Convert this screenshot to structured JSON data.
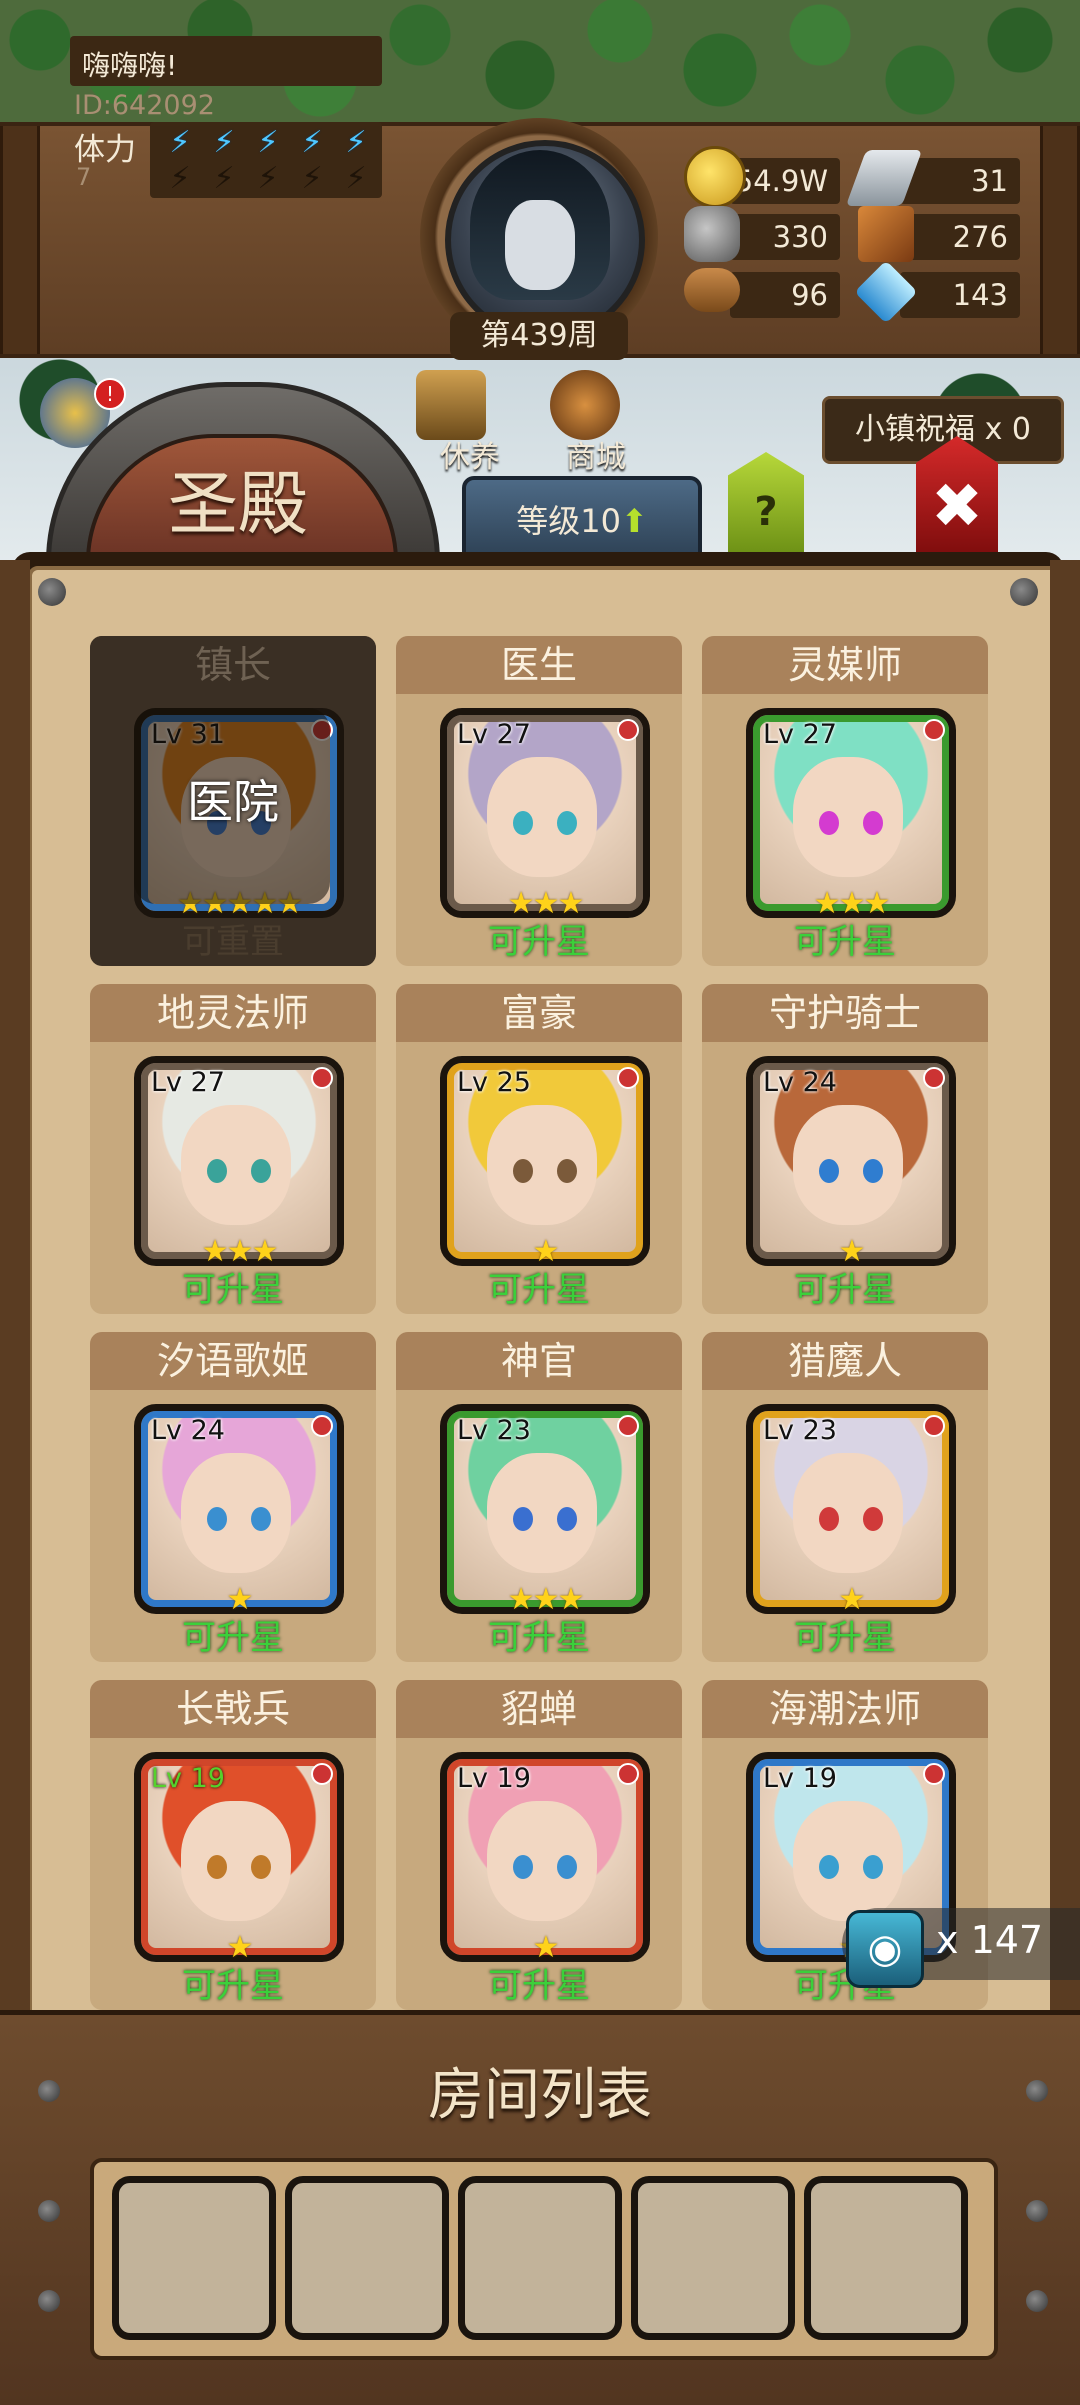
{
  "player": {
    "name": "嗨嗨嗨!",
    "id": "ID:642092",
    "stamina_label": "体力",
    "stamina_value": "7",
    "stamina_bolts_filled": 5,
    "stamina_bolts_total": 10,
    "week": "第439周"
  },
  "resources": {
    "gold": "54.9W",
    "iron": "31",
    "stone": "330",
    "leather": "276",
    "wood": "96",
    "crystal": "143"
  },
  "buildings": {
    "rest_label": "休养",
    "market_label": "商城",
    "blessing": "小镇祝福 x 0"
  },
  "hall": {
    "title": "圣殿",
    "level": "等级10",
    "help": "?",
    "close": "✖"
  },
  "heroes": [
    {
      "title": "镇长",
      "lv": "Lv 31",
      "stars": 5,
      "status": "可重置",
      "overlay": "医院",
      "frame": "#2f6fb3",
      "hair": "#e0801e",
      "eye": "#3a7bd5",
      "dim": true
    },
    {
      "title": "医生",
      "lv": "Lv 27",
      "stars": 3,
      "status": "可升星",
      "overlay": "",
      "frame": "#6b5a4a",
      "hair": "#b3a5c8",
      "eye": "#3bb0c0",
      "dim": false
    },
    {
      "title": "灵媒师",
      "lv": "Lv 27",
      "stars": 3,
      "status": "可升星",
      "overlay": "",
      "frame": "#3a9a2e",
      "hair": "#7fe0c4",
      "eye": "#d43bd0",
      "dim": false
    },
    {
      "title": "地灵法师",
      "lv": "Lv 27",
      "stars": 3,
      "status": "可升星",
      "overlay": "",
      "frame": "#6b5a4a",
      "hair": "#e6e9e3",
      "eye": "#3aa39a",
      "dim": false
    },
    {
      "title": "富豪",
      "lv": "Lv 25",
      "stars": 1,
      "status": "可升星",
      "overlay": "",
      "frame": "#e0a21c",
      "hair": "#f1c93a",
      "eye": "#7b5a3a",
      "dim": false
    },
    {
      "title": "守护骑士",
      "lv": "Lv 24",
      "stars": 1,
      "status": "可升星",
      "overlay": "",
      "frame": "#6b5a4a",
      "hair": "#b9683a",
      "eye": "#2f7dd0",
      "dim": false
    },
    {
      "title": "汐语歌姬",
      "lv": "Lv 24",
      "stars": 1,
      "status": "可升星",
      "overlay": "",
      "frame": "#2f78c8",
      "hair": "#e6a6d8",
      "eye": "#3a8fd0",
      "dim": false
    },
    {
      "title": "神官",
      "lv": "Lv 23",
      "stars": 3,
      "status": "可升星",
      "overlay": "",
      "frame": "#3a9a2e",
      "hair": "#6fd1a0",
      "eye": "#3a6fd0",
      "dim": false
    },
    {
      "title": "猎魔人",
      "lv": "Lv 23",
      "stars": 1,
      "status": "可升星",
      "overlay": "",
      "frame": "#e0a21c",
      "hair": "#d9d4e4",
      "eye": "#d03a3a",
      "dim": false
    },
    {
      "title": "长戟兵",
      "lv": "Lv 19",
      "stars": 1,
      "status": "可升星",
      "overlay": "",
      "frame": "#d0462a",
      "hair": "#e0502a",
      "eye": "#c07a2a",
      "dim": false,
      "lv_green": true
    },
    {
      "title": "貂蝉",
      "lv": "Lv 19",
      "stars": 1,
      "status": "可升星",
      "overlay": "",
      "frame": "#d0462a",
      "hair": "#f0a0b4",
      "eye": "#3a8fd0",
      "dim": false
    },
    {
      "title": "海潮法师",
      "lv": "Lv 19",
      "stars": 1,
      "status": "可升星",
      "overlay": "",
      "frame": "#2f78c8",
      "hair": "#bfe6ec",
      "eye": "#3a9fd0",
      "dim": false
    }
  ],
  "room_list": {
    "title": "房间列表",
    "slots": 5
  },
  "gems": {
    "count": "x 147"
  },
  "colors": {
    "status_green": "#3bd03a",
    "star_gold": "#ffd21a",
    "wood_dark": "#3c2814"
  }
}
